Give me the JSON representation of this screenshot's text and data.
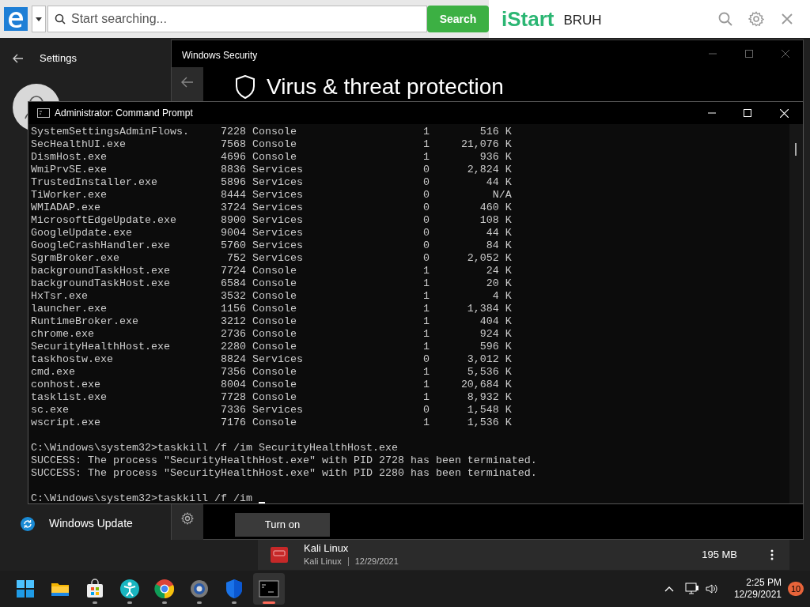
{
  "browser_toolbar": {
    "search": {
      "placeholder": "Start searching..."
    },
    "search_button": "Search",
    "brand": "iStart",
    "user": "BRUH"
  },
  "settings": {
    "title": "Settings",
    "nav_items": [
      {
        "label": "Windows Update"
      }
    ],
    "apps": [
      {
        "name": "Kali Linux",
        "publisher": "Kali Linux",
        "date": "12/29/2021",
        "size": "195 MB"
      }
    ]
  },
  "security": {
    "title": "Windows Security",
    "heading": "Virus & threat protection",
    "button": "Turn on"
  },
  "cmd": {
    "title": "Administrator: Command Prompt",
    "processes": [
      {
        "name": "SystemSettingsAdminFlows.",
        "pid": "7228",
        "session": "Console",
        "session_no": "1",
        "mem": "516 K"
      },
      {
        "name": "SecHealthUI.exe",
        "pid": "7568",
        "session": "Console",
        "session_no": "1",
        "mem": "21,076 K"
      },
      {
        "name": "DismHost.exe",
        "pid": "4696",
        "session": "Console",
        "session_no": "1",
        "mem": "936 K"
      },
      {
        "name": "WmiPrvSE.exe",
        "pid": "8836",
        "session": "Services",
        "session_no": "0",
        "mem": "2,824 K"
      },
      {
        "name": "TrustedInstaller.exe",
        "pid": "5896",
        "session": "Services",
        "session_no": "0",
        "mem": "44 K"
      },
      {
        "name": "TiWorker.exe",
        "pid": "8444",
        "session": "Services",
        "session_no": "0",
        "mem": "N/A"
      },
      {
        "name": "WMIADAP.exe",
        "pid": "3724",
        "session": "Services",
        "session_no": "0",
        "mem": "460 K"
      },
      {
        "name": "MicrosoftEdgeUpdate.exe",
        "pid": "8900",
        "session": "Services",
        "session_no": "0",
        "mem": "108 K"
      },
      {
        "name": "GoogleUpdate.exe",
        "pid": "9004",
        "session": "Services",
        "session_no": "0",
        "mem": "44 K"
      },
      {
        "name": "GoogleCrashHandler.exe",
        "pid": "5760",
        "session": "Services",
        "session_no": "0",
        "mem": "84 K"
      },
      {
        "name": "SgrmBroker.exe",
        "pid": "752",
        "session": "Services",
        "session_no": "0",
        "mem": "2,052 K"
      },
      {
        "name": "backgroundTaskHost.exe",
        "pid": "7724",
        "session": "Console",
        "session_no": "1",
        "mem": "24 K"
      },
      {
        "name": "backgroundTaskHost.exe",
        "pid": "6584",
        "session": "Console",
        "session_no": "1",
        "mem": "20 K"
      },
      {
        "name": "HxTsr.exe",
        "pid": "3532",
        "session": "Console",
        "session_no": "1",
        "mem": "4 K"
      },
      {
        "name": "launcher.exe",
        "pid": "1156",
        "session": "Console",
        "session_no": "1",
        "mem": "1,384 K"
      },
      {
        "name": "RuntimeBroker.exe",
        "pid": "3212",
        "session": "Console",
        "session_no": "1",
        "mem": "404 K"
      },
      {
        "name": "chrome.exe",
        "pid": "2736",
        "session": "Console",
        "session_no": "1",
        "mem": "924 K"
      },
      {
        "name": "SecurityHealthHost.exe",
        "pid": "2280",
        "session": "Console",
        "session_no": "1",
        "mem": "596 K"
      },
      {
        "name": "taskhostw.exe",
        "pid": "8824",
        "session": "Services",
        "session_no": "0",
        "mem": "3,012 K"
      },
      {
        "name": "cmd.exe",
        "pid": "7356",
        "session": "Console",
        "session_no": "1",
        "mem": "5,536 K"
      },
      {
        "name": "conhost.exe",
        "pid": "8004",
        "session": "Console",
        "session_no": "1",
        "mem": "20,684 K"
      },
      {
        "name": "tasklist.exe",
        "pid": "7728",
        "session": "Console",
        "session_no": "1",
        "mem": "8,932 K"
      },
      {
        "name": "sc.exe",
        "pid": "7336",
        "session": "Services",
        "session_no": "0",
        "mem": "1,548 K"
      },
      {
        "name": "wscript.exe",
        "pid": "7176",
        "session": "Console",
        "session_no": "1",
        "mem": "1,536 K"
      }
    ],
    "lines": [
      {
        "kind": "blank"
      },
      {
        "kind": "command",
        "prompt": "C:\\Windows\\system32>",
        "text": "taskkill /f /im SecurityHealthHost.exe"
      },
      {
        "kind": "output",
        "text": "SUCCESS: The process \"SecurityHealthHost.exe\" with PID 2728 has been terminated."
      },
      {
        "kind": "output",
        "text": "SUCCESS: The process \"SecurityHealthHost.exe\" with PID 2280 has been terminated."
      },
      {
        "kind": "blank"
      },
      {
        "kind": "input",
        "prompt": "C:\\Windows\\system32>",
        "text": "taskkill /f /im "
      }
    ]
  },
  "taskbar": {
    "apps": [
      {
        "kind": "start",
        "running": false,
        "active": false
      },
      {
        "kind": "folder",
        "running": false,
        "active": false
      },
      {
        "kind": "store",
        "running": true,
        "active": false
      },
      {
        "kind": "person",
        "running": true,
        "active": false
      },
      {
        "kind": "browser",
        "running": true,
        "active": false
      },
      {
        "kind": "gear",
        "running": true,
        "active": false
      },
      {
        "kind": "shield",
        "running": true,
        "active": false
      },
      {
        "kind": "terminal",
        "running": true,
        "active": true
      }
    ],
    "time": "2:25 PM",
    "date": "12/29/2021",
    "notifications": "10"
  }
}
